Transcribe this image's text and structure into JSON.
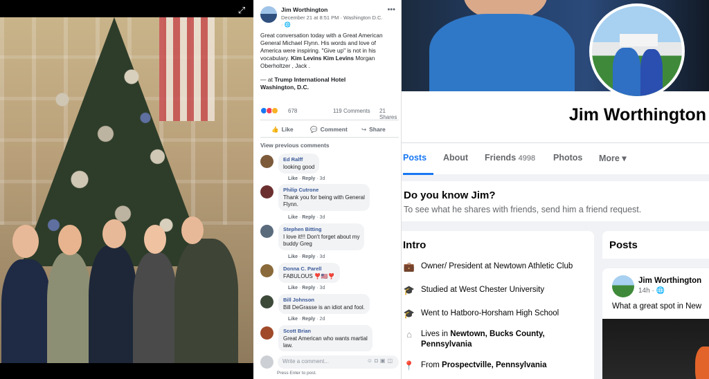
{
  "post": {
    "author": "Jim Worthington",
    "meta": "December 21 at 8:51 PM · Washington D.C. · ",
    "more_icon": "ellipsis-icon",
    "body_lines": [
      "Great conversation today with a Great American",
      "General Michael Flynn. His words and love of",
      "America were inspiring. \"Give up\" is not in his",
      "vocabulary."
    ],
    "tags": "Kim Levins Kim Levins",
    "tags_rest": " Morgan",
    "tags_line2": "Oberholtzer , Jack .",
    "checkin_prefix": "— at ",
    "checkin_place_1": "Trump International Hotel",
    "checkin_place_2": "Washington, D.C.",
    "reaction_count": "678",
    "comments_count": "119 Comments",
    "shares_count": "21 Shares",
    "actions": {
      "like": "Like",
      "comment": "Comment",
      "share": "Share"
    },
    "view_previous": "View previous comments",
    "write_placeholder": "Write a comment...",
    "press_enter": "Press Enter to post.",
    "reaction_colors": [
      "#1877f2",
      "#f33e58",
      "#f7b125"
    ]
  },
  "comments": [
    {
      "name": "Ed Ralff",
      "lines": [
        "looking good"
      ],
      "time": "3d"
    },
    {
      "name": "Philip Cutrone",
      "lines": [
        "Thank you for being with General",
        "Flynn."
      ],
      "time": "3d"
    },
    {
      "name": "Stephen Bitting",
      "lines": [
        "I love it!!! Don't forget about my",
        "buddy Greg"
      ],
      "time": "3d"
    },
    {
      "name": "Donna C. Parell",
      "lines": [
        "FABULOUS ❣️🇺🇸❣️"
      ],
      "time": "3d"
    },
    {
      "name": "Bill Johnson",
      "lines": [
        "Bill DeGrasse is an idiot and fool."
      ],
      "time": "2d"
    },
    {
      "name": "Scott Brian",
      "lines": [
        "Great American who wants martial",
        "law."
      ],
      "time": ""
    }
  ],
  "comment_actions": {
    "like": "Like",
    "reply": "Reply",
    "sep": " · "
  },
  "profile": {
    "name": "Jim Worthington",
    "tabs": {
      "posts": "Posts",
      "about": "About",
      "friends": "Friends",
      "friends_count": "4998",
      "photos": "Photos",
      "more": "More ▾"
    },
    "know_title": "Do you know Jim?",
    "know_sub": "To see what he shares with friends, send him a friend request.",
    "intro_title": "Intro",
    "intro": [
      {
        "icon": "briefcase-icon",
        "text": "Owner/ President at Newtown Athletic Club"
      },
      {
        "icon": "graduation-cap-icon",
        "text": "Studied at West Chester University"
      },
      {
        "icon": "graduation-cap-icon",
        "text": "Went to Hatboro-Horsham High School"
      },
      {
        "icon": "house-icon",
        "prefix": "Lives in ",
        "bold": "Newtown, Bucks County,",
        "bold2": "Pennsylvania"
      },
      {
        "icon": "location-pin-icon",
        "prefix": "From ",
        "bold": "Prospectville, Pennsylvania"
      }
    ],
    "posts_title": "Posts",
    "preview": {
      "name": "Jim Worthington",
      "time": "14h · 🌐",
      "text": "What a great spot in New"
    }
  }
}
